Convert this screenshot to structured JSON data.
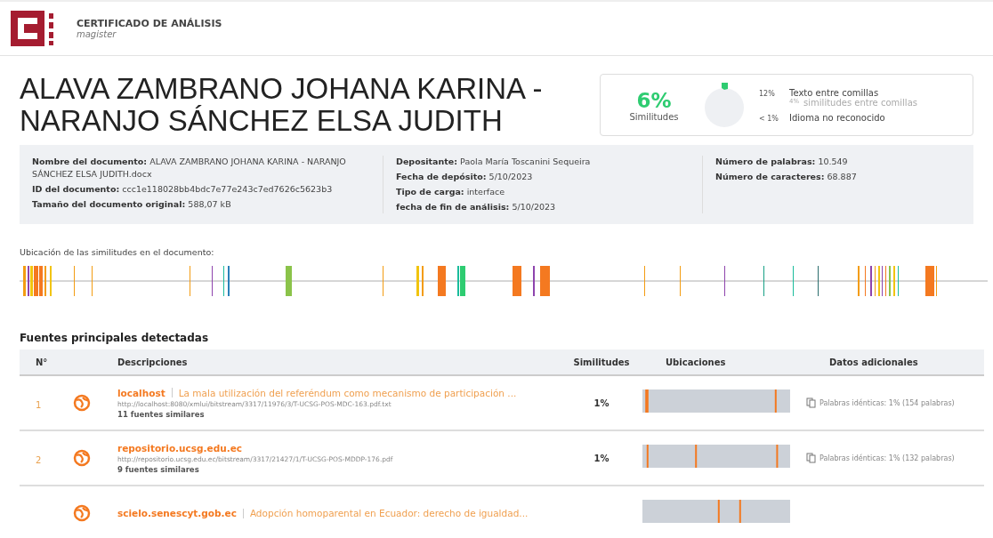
{
  "header": {
    "title": "CERTIFICADO DE ANÁLISIS",
    "subtitle": "magister"
  },
  "document_title": "ALAVA ZAMBRANO JOHANA KARINA - NARANJO SÁNCHEZ ELSA JUDITH",
  "summary": {
    "percent": "6%",
    "label": "Similitudes",
    "quotes_percent": "12%",
    "quotes_label": "Texto entre comillas",
    "quote_sim_percent": "4%",
    "quote_sim_label": "similitudes entre comillas",
    "lang_percent": "< 1%",
    "lang_label": "Idioma no reconocido"
  },
  "info_columns": [
    [
      {
        "label": "Nombre del documento:",
        "value": "ALAVA ZAMBRANO JOHANA KARINA - NARANJO SÁNCHEZ ELSA JUDITH.docx"
      },
      {
        "label": "ID del documento:",
        "value": "ccc1e118028bb4bdc7e77e243c7ed7626c5623b3"
      },
      {
        "label": "Tamaño del documento original:",
        "value": "588,07 kB"
      }
    ],
    [
      {
        "label": "Depositante:",
        "value": "Paola María Toscanini Sequeira"
      },
      {
        "label": "Fecha de depósito:",
        "value": "5/10/2023"
      },
      {
        "label": "Tipo de carga:",
        "value": "interface"
      },
      {
        "label": "fecha de fin de análisis:",
        "value": "5/10/2023"
      }
    ],
    [
      {
        "label": "Número de palabras:",
        "value": "10.549"
      },
      {
        "label": "Número de caracteres:",
        "value": "68.887"
      }
    ]
  ],
  "location_label": "Ubicación de las similitudes en el documento:",
  "sources_title": "Fuentes principales detectadas",
  "table": {
    "columns": [
      "N°",
      "Descripciones",
      "Similitudes",
      "Ubicaciones",
      "Datos adicionales"
    ],
    "rows": [
      {
        "number": "1",
        "source": "localhost",
        "title": "La mala utilización del referéndum como mecanismo de participación ...",
        "url": "http://localhost:8080/xmlui/bitstream/3317/11976/3/T-UCSG-POS-MDC-163.pdf.txt",
        "similar": "11 fuentes similares",
        "similarity": "1%",
        "extra": "Palabras idénticas: 1% (154 palabras)"
      },
      {
        "number": "2",
        "source": "repositorio.ucsg.edu.ec",
        "url": "http://repositorio.ucsg.edu.ec/bitstream/3317/21427/1/T-UCSG-POS-MDDP-176.pdf",
        "similar": "9 fuentes similares",
        "similarity": "1%",
        "extra": "Palabras idénticas: 1% (132 palabras)"
      },
      {
        "source": "scielo.senescyt.gob.ec",
        "title": "Adopción homoparental en Ecuador: derecho de igualdad..."
      }
    ]
  }
}
